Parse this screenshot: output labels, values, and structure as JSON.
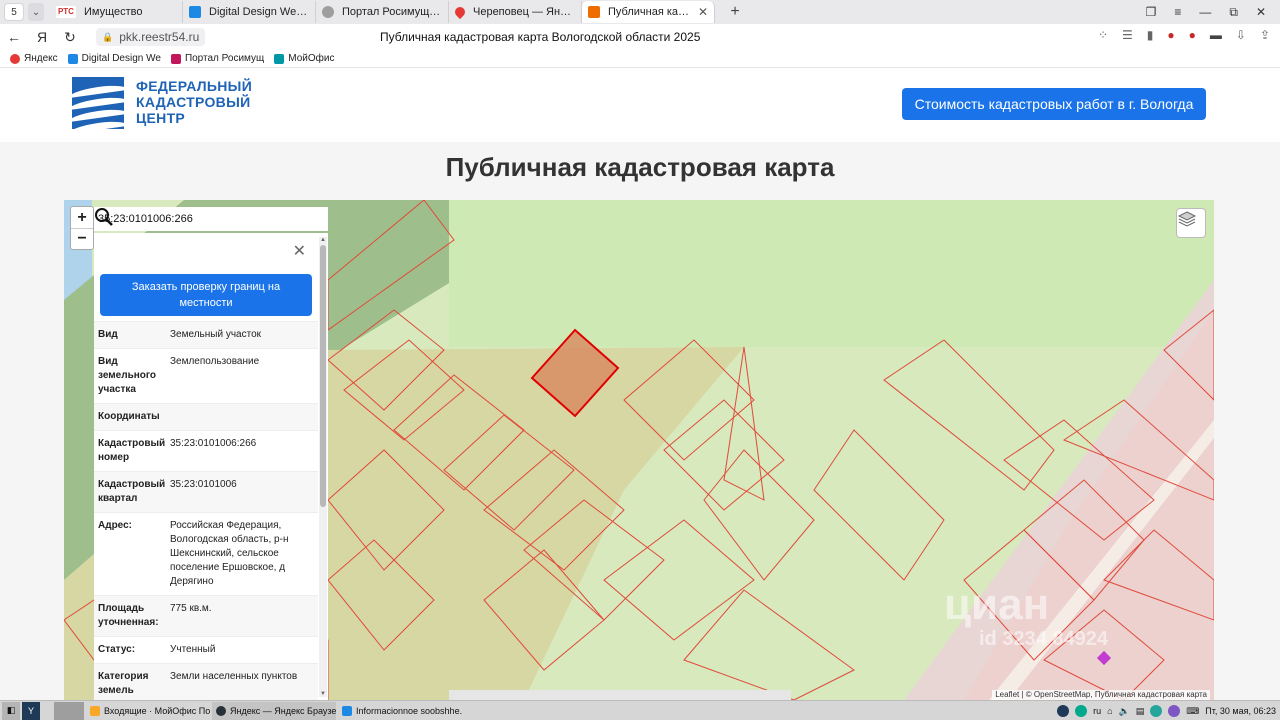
{
  "browser": {
    "tab_counter": "5",
    "tabs": [
      {
        "title": "Имущество",
        "favicon": "РТС",
        "color": "#d32f2f"
      },
      {
        "title": "Digital Design Web Client",
        "favicon": "",
        "color": "#1e88e5"
      },
      {
        "title": "Портал Росимущества",
        "favicon": "",
        "color": "#9e9e9e"
      },
      {
        "title": "Череповец — Яндекс Карты",
        "favicon": "",
        "color": "#e53935"
      },
      {
        "title": "Публичная кадастровая",
        "favicon": "",
        "color": "#ef6c00"
      }
    ],
    "url": "pkk.reestr54.ru",
    "page_title": "Публичная кадастровая карта Вологодской области 2025",
    "bookmarks": [
      {
        "label": "Яндекс",
        "color": "#e53935"
      },
      {
        "label": "Digital Design We",
        "color": "#1e88e5"
      },
      {
        "label": "Портал Росимущ",
        "color": "#c2185b"
      },
      {
        "label": "МойОфис",
        "color": "#0097a7"
      }
    ]
  },
  "site": {
    "logo_text": "ФЕДЕРАЛЬНЫЙ КАДАСТРОВЫЙ ЦЕНТР",
    "cta_label": "Стоимость кадастровых работ в г. Вологда",
    "heading": "Публичная кадастровая карта"
  },
  "map": {
    "search_value": "35:23:0101006:266",
    "zoom_in": "+",
    "zoom_out": "−",
    "attribution": "Leaflet | © OpenStreetMap, Публичная кадастровая карта",
    "watermark": "циан",
    "watermark_id": "id 3234 84924"
  },
  "panel": {
    "order_button": "Заказать проверку границ на местности",
    "rows": [
      {
        "k": "Вид",
        "v": "Земельный участок"
      },
      {
        "k": "Вид земельного участка",
        "v": "Землепользование"
      },
      {
        "k": "Координаты",
        "v": ""
      },
      {
        "k": "Кадастровый номер",
        "v": "35:23:0101006:266"
      },
      {
        "k": "Кадастровый квартал",
        "v": "35:23:0101006"
      },
      {
        "k": "Адрес:",
        "v": "Российская Федерация, Вологодская область, р-н Шекснинский, сельское поселение Ершовское, д Дерягино"
      },
      {
        "k": "Площадь уточненная:",
        "v": "775 кв.м."
      },
      {
        "k": "Статус:",
        "v": "Учтенный"
      },
      {
        "k": "Категория земель",
        "v": "Земли населенных пунктов"
      }
    ]
  },
  "taskbar": {
    "apps": [
      {
        "label": "Входящие · МойОфис По...",
        "color": "#f9a825"
      },
      {
        "label": "Яндекс — Яндекс Браузер",
        "color": "#263238"
      },
      {
        "label": "Informacionnoe soobshhe...",
        "color": "#1e88e5"
      }
    ],
    "lang": "ru",
    "clock": "Пт, 30 мая, 06:23"
  },
  "colors": {
    "accent": "#1a73e8",
    "brand": "#1e63b5",
    "parcel_outline": "#e53935",
    "selected_parcel": "#d9825a"
  }
}
